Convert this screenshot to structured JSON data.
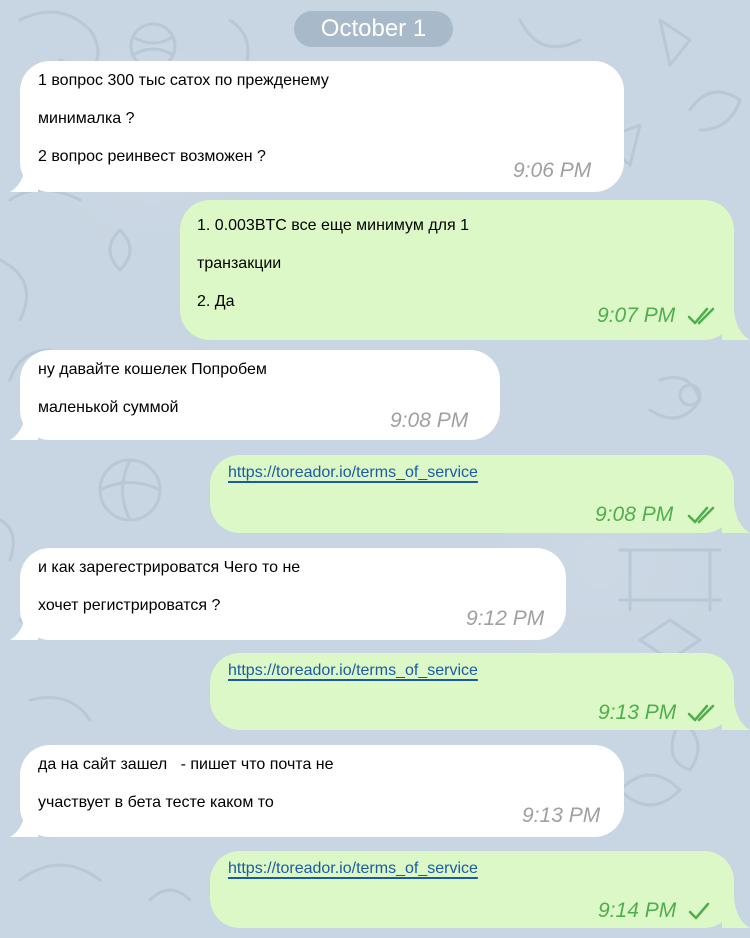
{
  "date_pill": "October 1",
  "colors": {
    "incoming_bubble": "#ffffff",
    "outgoing_bubble": "#dcf8c6",
    "outgoing_time": "#4fae4e",
    "incoming_time": "#a0a0a0",
    "link": "#1b5ba6",
    "wallpaper": "#c8d5e2"
  },
  "messages": [
    {
      "direction": "in",
      "lines": [
        "1 вопрос 300 тыс сатох по прежденему",
        "минималка ?",
        "2 вопрос реинвест возможен ?"
      ],
      "time": "9:06 PM"
    },
    {
      "direction": "out",
      "lines": [
        "1. 0.003BTC все еще минимум для 1",
        "транзакции",
        "2. Да"
      ],
      "time": "9:07 PM",
      "status_icon": "double-check-icon"
    },
    {
      "direction": "in",
      "lines": [
        "ну давайте кошелек Попробем",
        "маленькой суммой"
      ],
      "time": "9:08 PM"
    },
    {
      "direction": "out",
      "link": "https://toreador.io/terms_of_service",
      "time": "9:08 PM",
      "status_icon": "double-check-icon"
    },
    {
      "direction": "in",
      "lines": [
        "и как зарегестрироватся Чего то не",
        "хочет регистрироватся ?"
      ],
      "time": "9:12 PM"
    },
    {
      "direction": "out",
      "link": "https://toreador.io/terms_of_service",
      "time": "9:13 PM",
      "status_icon": "double-check-icon"
    },
    {
      "direction": "in",
      "lines": [
        "да на сайт зашел   - пишет что почта не",
        "участвует в бета тесте каком то"
      ],
      "time": "9:13 PM"
    },
    {
      "direction": "out",
      "link": "https://toreador.io/terms_of_service",
      "time": "9:14 PM",
      "status_icon": "single-check-icon"
    }
  ]
}
